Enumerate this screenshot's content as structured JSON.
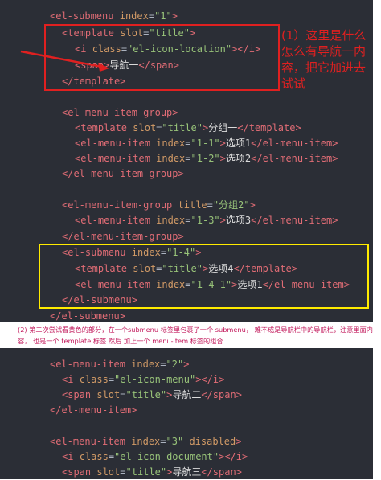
{
  "annotations": {
    "red_note": "(1）这里是什么怎么有导航一内容，把它加进去试试",
    "purple_note": "(2) 第二次尝试看黄色的部分，在一个submenu 标签里包裹了一个 submenu， 难不成是导航栏中的导航栏，注意里面内容，   也是一个 template 标签 然后 加上一个   menu-item 标签的组合"
  },
  "code": {
    "l01": {
      "t1": "<el-submenu",
      "a1": "index",
      "s1": "\"1\"",
      "p1": ">"
    },
    "l02": {
      "t1": "<template",
      "a1": "slot",
      "s1": "\"title\"",
      "p1": ">"
    },
    "l03": {
      "t1": "<i",
      "a1": "class",
      "s1": "\"el-icon-location\"",
      "p1": "></",
      "t2": "i",
      "p2": ">"
    },
    "l04": {
      "t1": "<span",
      "p1": ">",
      "txt": "导航一",
      "p2": "</",
      "t2": "span",
      "p3": ">"
    },
    "l05": {
      "t1": "</template",
      "p1": ">"
    },
    "l06": {
      "t1": "<el-menu-item-group",
      "p1": ">"
    },
    "l07": {
      "t1": "<template",
      "a1": "slot",
      "s1": "\"title\"",
      "p1": ">",
      "txt": "分组一",
      "p2": "</",
      "t2": "template",
      "p3": ">"
    },
    "l08": {
      "t1": "<el-menu-item",
      "a1": "index",
      "s1": "\"1-1\"",
      "p1": ">",
      "txt": "选项1",
      "p2": "</",
      "t2": "el-menu-item",
      "p3": ">"
    },
    "l09": {
      "t1": "<el-menu-item",
      "a1": "index",
      "s1": "\"1-2\"",
      "p1": ">",
      "txt": "选项2",
      "p2": "</",
      "t2": "el-menu-item",
      "p3": ">"
    },
    "l10": {
      "t1": "</el-menu-item-group",
      "p1": ">"
    },
    "l11": {
      "t1": "<el-menu-item-group",
      "a1": "title",
      "s1": "\"分组2\"",
      "p1": ">"
    },
    "l12": {
      "t1": "<el-menu-item",
      "a1": "index",
      "s1": "\"1-3\"",
      "p1": ">",
      "txt": "选项3",
      "p2": "</",
      "t2": "el-menu-item",
      "p3": ">"
    },
    "l13": {
      "t1": "</el-menu-item-group",
      "p1": ">"
    },
    "l14": {
      "t1": "<el-submenu",
      "a1": "index",
      "s1": "\"1-4\"",
      "p1": ">"
    },
    "l15": {
      "t1": "<template",
      "a1": "slot",
      "s1": "\"title\"",
      "p1": ">",
      "txt": "选项4",
      "p2": "</",
      "t2": "template",
      "p3": ">"
    },
    "l16": {
      "t1": "<el-menu-item",
      "a1": "index",
      "s1": "\"1-4-1\"",
      "p1": ">",
      "txt": "选项1",
      "p2": "</",
      "t2": "el-menu-item",
      "p3": ">"
    },
    "l17": {
      "t1": "</el-submenu",
      "p1": ">"
    },
    "l18": {
      "t1": "</el-submenu",
      "p1": ">"
    },
    "l19": {
      "t1": "<el-menu-item",
      "a1": "index",
      "s1": "\"2\"",
      "p1": ">"
    },
    "l20": {
      "t1": "<i",
      "a1": "class",
      "s1": "\"el-icon-menu\"",
      "p1": "></",
      "t2": "i",
      "p2": ">"
    },
    "l21": {
      "t1": "<span",
      "a1": "slot",
      "s1": "\"title\"",
      "p1": ">",
      "txt": "导航二",
      "p2": "</",
      "t2": "span",
      "p3": ">"
    },
    "l22": {
      "t1": "</el-menu-item",
      "p1": ">"
    },
    "l23": {
      "t1": "<el-menu-item",
      "a1": "index",
      "s1": "\"3\"",
      "a2": "disabled",
      "p1": ">"
    },
    "l24": {
      "t1": "<i",
      "a1": "class",
      "s1": "\"el-icon-document\"",
      "p1": "></",
      "t2": "i",
      "p2": ">"
    },
    "l25": {
      "t1": "<span",
      "a1": "slot",
      "s1": "\"title\"",
      "p1": ">",
      "txt": "导航三",
      "p2": "</",
      "t2": "span",
      "p3": ">"
    }
  }
}
